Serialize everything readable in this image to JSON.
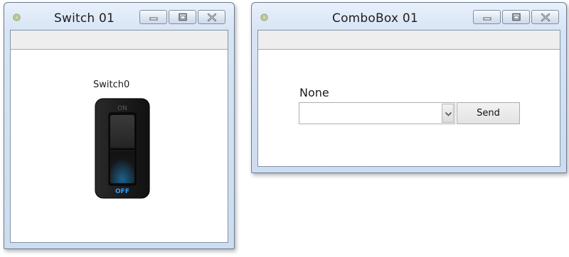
{
  "windows": {
    "switch_window": {
      "title": "Switch 01",
      "icon": "app-gear-icon",
      "controls": [
        "minimize-icon",
        "maximize-icon",
        "close-icon"
      ],
      "switch": {
        "label": "Switch0",
        "top_text": "ON",
        "bottom_text": "OFF",
        "state": "off"
      }
    },
    "combobox_window": {
      "title": "ComboBox 01",
      "icon": "app-gear-icon",
      "controls": [
        "minimize-icon",
        "maximize-icon",
        "close-icon"
      ],
      "label": "None",
      "combobox": {
        "value": "",
        "dropdown_icon": "chevron-down-icon"
      },
      "send_label": "Send"
    }
  },
  "colors": {
    "switch_off_text": "#2ea3ff",
    "switch_body": "#1d1d1d",
    "titlebar": "#d6e4f4"
  }
}
